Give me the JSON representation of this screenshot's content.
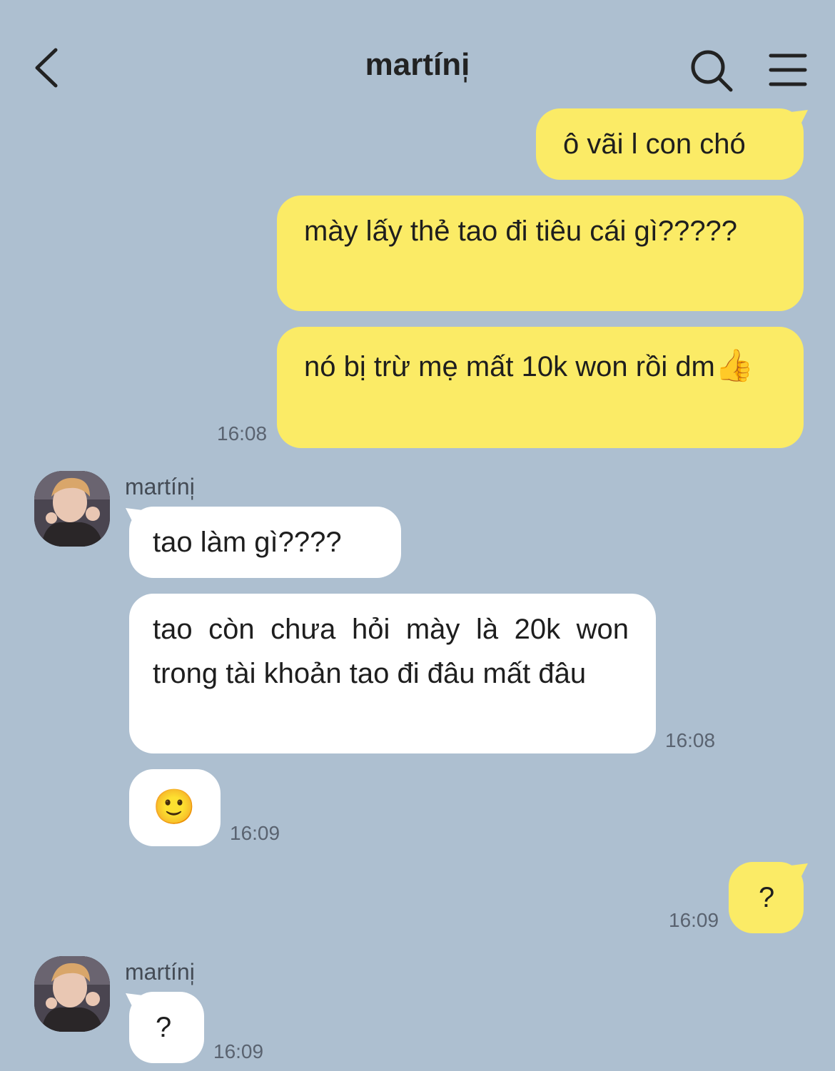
{
  "header": {
    "title": "martíni̩"
  },
  "messages": [
    {
      "from": "me",
      "text": "ô vãi l con chó"
    },
    {
      "from": "me",
      "text": "mày lấy thẻ tao đi tiêu cái gì?????"
    },
    {
      "from": "me",
      "text": "nó bị trừ mẹ mất 10k won rồi dm",
      "emoji": "👍",
      "time": "16:08"
    },
    {
      "from": "other",
      "sender": "martíni̩",
      "text": "tao làm gì????"
    },
    {
      "from": "other",
      "text": "tao còn chưa hỏi mày là 20k won trong tài khoản tao đi đâu mất đâu",
      "time": "16:08"
    },
    {
      "from": "other",
      "emoji": "🙂",
      "time": "16:09"
    },
    {
      "from": "me",
      "text": "?",
      "time": "16:09"
    },
    {
      "from": "other",
      "sender": "martíni̩",
      "text": "?",
      "time": "16:09"
    }
  ],
  "colors": {
    "background": "#adbfd0",
    "my_bubble": "#fbeb66",
    "their_bubble": "#ffffff"
  },
  "icons": {
    "back": "chevron-left-icon",
    "search": "search-icon",
    "menu": "hamburger-menu-icon"
  }
}
